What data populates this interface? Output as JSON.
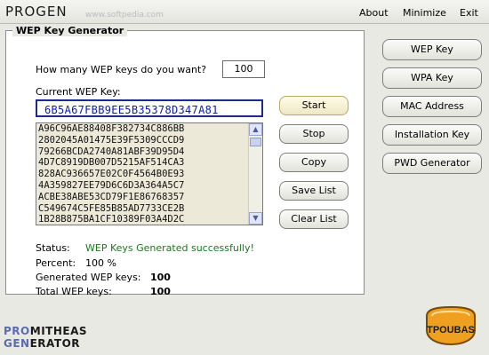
{
  "app": {
    "title": "PROGEN",
    "watermark": "www.softpedia.com"
  },
  "menu": {
    "about": "About",
    "minimize": "Minimize",
    "exit": "Exit"
  },
  "generator": {
    "legend": "WEP Key Generator",
    "how_many_label": "How many WEP keys do you want?",
    "how_many_value": "100",
    "current_key_label": "Current WEP Key:",
    "current_key": "6B5A67FBB9EE5B35378D347A81",
    "keys": [
      "A96C96AE88408F382734C886BB",
      "2802045A01475E39F5309CCCD9",
      "79266BCDA2740A81ABF39D95D4",
      "4D7C8919DB007D5215AF514CA3",
      "828AC936657E02C0F4564B0E93",
      "4A359827EE79D6C6D3A364A5C7",
      "ACBE38ABE53CD79F1E86768357",
      "C549674C5FE85B85AD7733CE2B",
      "1B28B875BA1CF10389F03A4D2C"
    ],
    "buttons": {
      "start": "Start",
      "stop": "Stop",
      "copy": "Copy",
      "save_list": "Save List",
      "clear_list": "Clear List"
    },
    "status_label": "Status:",
    "status_value": "WEP Keys Generated successfully!",
    "percent_label": "Percent:",
    "percent_value": "100 %",
    "generated_label": "Generated WEP keys:",
    "generated_value": "100",
    "total_label": "Total WEP keys:",
    "total_value": "100"
  },
  "sidebar": {
    "wep_key": "WEP Key",
    "wpa_key": "WPA Key",
    "mac_address": "MAC Address",
    "installation_key": "Installation Key",
    "pwd_generator": "PWD Generator"
  },
  "brand": {
    "line1_a": "PRO",
    "line1_b": "MITHEAS",
    "line2_a": "GEN",
    "line2_b": "ERATOR",
    "badge": "TPOUBAS"
  },
  "colors": {
    "status_ok": "#1b7a1b",
    "key_text": "#0b1bb0",
    "badge_orange": "#f0a020"
  }
}
